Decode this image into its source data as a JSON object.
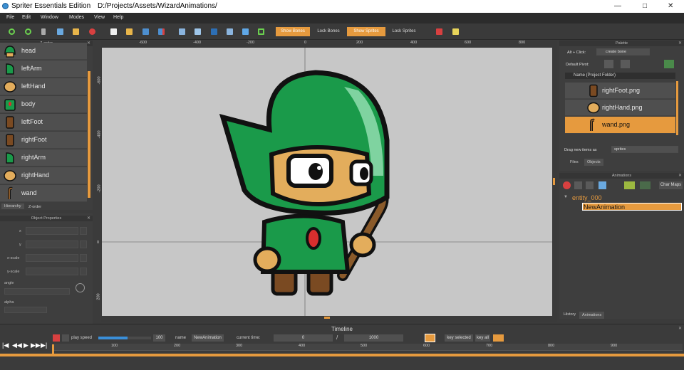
{
  "window": {
    "app_name": "Spriter Essentials Edition",
    "project_path": "D:/Projects/Assets/WizardAnimations/",
    "buttons": {
      "minimize": "—",
      "maximize": "□",
      "close": "✕"
    }
  },
  "menu": [
    "File",
    "Edit",
    "Window",
    "Modes",
    "View",
    "Help"
  ],
  "toolbar": {
    "show_bones": "Show Bones",
    "lock_bones": "Lock Bones",
    "show_sprites": "Show Sprites",
    "lock_sprites": "Lock Sprites"
  },
  "zorder": {
    "title": "Z-order",
    "items": [
      "head",
      "leftArm",
      "leftHand",
      "body",
      "leftFoot",
      "rightFoot",
      "rightArm",
      "rightHand",
      "wand"
    ],
    "tabs": [
      "Hierarchy",
      "Z-order"
    ]
  },
  "object_properties": {
    "title": "Object Properties",
    "labels": {
      "x": "x",
      "y": "y",
      "xscale": "x-scale",
      "yscale": "y-scale",
      "angle": "angle",
      "alpha": "alpha"
    }
  },
  "canvas": {
    "ruler_top": [
      "-600",
      "-400",
      "-200",
      "0",
      "200",
      "400",
      "600",
      "800"
    ],
    "ruler_left": [
      "-600",
      "-400",
      "-200",
      "0",
      "200"
    ]
  },
  "palette": {
    "title": "Palette",
    "alt_click_label": "Alt + Click:",
    "alt_click_value": "create bone",
    "default_pivot_label": "Default Pivot:",
    "name_header": "Name   (Project Folder)",
    "files": [
      "rightFoot.png",
      "rightHand.png",
      "wand.png"
    ],
    "selected_file": "wand.png",
    "drag_label": "Drag new items as",
    "drag_value": "sprites",
    "tabs": [
      "Files",
      "Objects"
    ]
  },
  "animations": {
    "title": "Animations",
    "char_maps": "Char Maps",
    "entity": "entity_000",
    "animation": "NewAnimation",
    "tabs": [
      "History",
      "Animations"
    ]
  },
  "timeline": {
    "title": "Timeline",
    "play_speed_label": "play speed",
    "play_speed_value": "100",
    "play_speed_fraction": 0.55,
    "name_label": "name",
    "name_value": "NewAnimation",
    "current_time_label": "current time:",
    "current_time": "0",
    "separator": "/",
    "total_time": "1000",
    "key_selected": "key selected",
    "key_all": "key all",
    "ticks": [
      "100",
      "200",
      "300",
      "400",
      "500",
      "600",
      "700",
      "800",
      "900"
    ],
    "transport": [
      "|◀",
      "◀◀",
      "▶",
      "▶▶",
      "▶|"
    ]
  },
  "colors": {
    "accent": "#e69a3e",
    "panel": "#3e3e3e",
    "canvas": "#c7c7c7",
    "hood_green": "#1a9a4a",
    "skin": "#e3ad5c",
    "outline": "#111111"
  }
}
